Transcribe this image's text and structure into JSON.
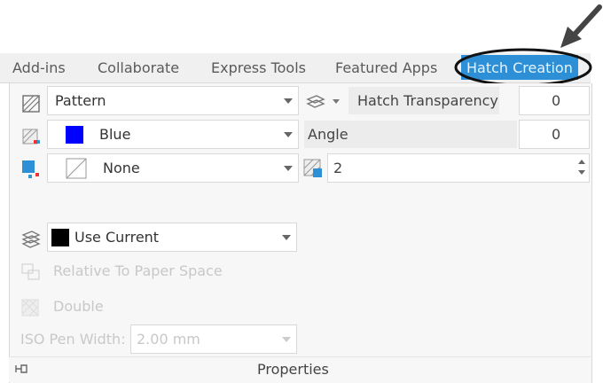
{
  "tabs": [
    {
      "label": "Add-ins"
    },
    {
      "label": "Collaborate"
    },
    {
      "label": "Express Tools"
    },
    {
      "label": "Featured Apps"
    },
    {
      "label": "Hatch Creation"
    }
  ],
  "row1": {
    "hatch_type": "Pattern",
    "transparency_label": "Hatch Transparency",
    "transparency_value": "0"
  },
  "row2": {
    "color": "Blue",
    "color_hex": "#0000ff",
    "angle_label": "Angle",
    "angle_value": "0"
  },
  "row3": {
    "background": "None",
    "scale_value": "2"
  },
  "layer": {
    "value": "Use Current"
  },
  "options": {
    "relative_label": "Relative To Paper Space",
    "double_label": "Double",
    "iso_label": "ISO Pen Width:",
    "iso_value": "2.00 mm"
  },
  "footer": {
    "title": "Properties"
  },
  "accent": "#2d8fd6"
}
